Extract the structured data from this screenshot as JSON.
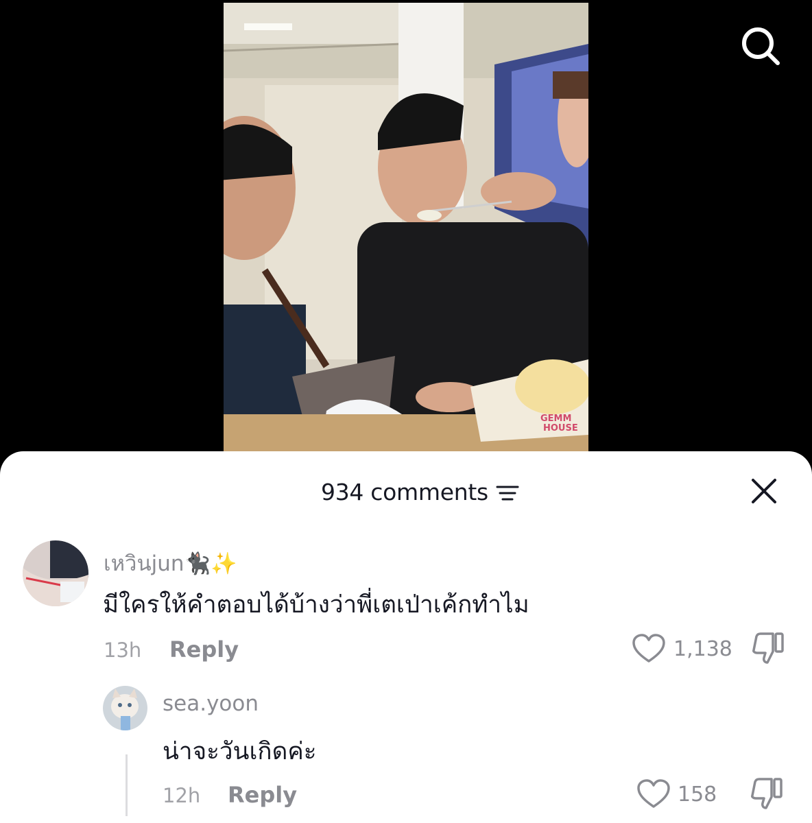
{
  "sheet": {
    "count_label": "934 comments"
  },
  "comments": [
    {
      "username": "เหวินjun🐈‍⬛✨",
      "text": "มีใครให้คำตอบได้บ้างว่าพี่เตเป่าเค้กทำไม",
      "time": "13h",
      "reply_label": "Reply",
      "likes": "1,138"
    }
  ],
  "replies": [
    {
      "username": "sea.yoon",
      "text": "น่าจะวันเกิดค่ะ",
      "time": "12h",
      "reply_label": "Reply",
      "likes": "158"
    }
  ],
  "video": {
    "box_label_line1": "GEMM",
    "box_label_line2": "HOUSE"
  },
  "icons": {
    "search": "search-icon",
    "sort": "sort-icon",
    "close": "close-icon",
    "like": "heart-icon",
    "dislike": "thumbs-down-icon"
  },
  "colors": {
    "text_primary": "#161823",
    "text_secondary": "#8a8b91",
    "background": "#000000",
    "sheet": "#ffffff"
  }
}
